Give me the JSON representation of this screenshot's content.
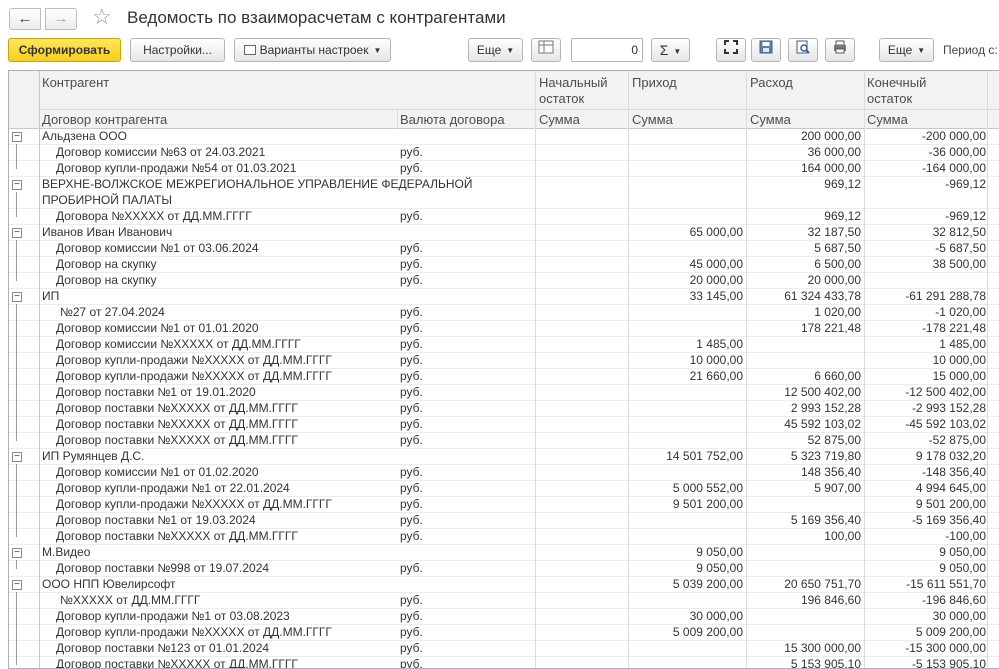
{
  "window": {
    "title": "Ведомость по взаиморасчетам с контрагентами",
    "back_glyph": "←",
    "forward_glyph": "→",
    "star_glyph": "☆"
  },
  "toolbar": {
    "generate_label": "Сформировать",
    "settings_label": "Настройки...",
    "variants_label": "Варианты настроек",
    "more1_label": "Еще",
    "number_value": "0",
    "sigma_label": "Σ",
    "more2_label": "Еще",
    "period_label": "Период с:"
  },
  "table": {
    "headers": {
      "counterparty": "Контрагент",
      "contract": "Договор контрагента",
      "currency": "Валюта договора",
      "opening": "Начальный остаток",
      "income": "Приход",
      "expense": "Расход",
      "closing": "Конечный остаток",
      "sum": "Сумма"
    },
    "rows": [
      {
        "level": 0,
        "name": "Альдзена ООО",
        "cur": "",
        "open": "",
        "inc": "",
        "exp": "200 000,00",
        "close": "-200 000,00"
      },
      {
        "level": 1,
        "name": "Договор комиссии №63 от 24.03.2021",
        "cur": "руб.",
        "open": "",
        "inc": "",
        "exp": "36 000,00",
        "close": "-36 000,00"
      },
      {
        "level": 1,
        "name": "Договор купли-продажи №54 от 01.03.2021",
        "cur": "руб.",
        "open": "",
        "inc": "",
        "exp": "164 000,00",
        "close": "-164 000,00"
      },
      {
        "level": 0,
        "name": "ВЕРХНЕ-ВОЛЖСКОЕ МЕЖРЕГИОНАЛЬНОЕ УПРАВЛЕНИЕ ФЕДЕРАЛЬНОЙ",
        "name2": "ПРОБИРНОЙ ПАЛАТЫ",
        "cur": "",
        "open": "",
        "inc": "",
        "exp": "969,12",
        "close": "-969,12"
      },
      {
        "level": 1,
        "name": "Договора №XXXXX от ДД.ММ.ГГГГ",
        "cur": "руб.",
        "open": "",
        "inc": "",
        "exp": "969,12",
        "close": "-969,12"
      },
      {
        "level": 0,
        "name": "Иванов Иван Иванович",
        "cur": "",
        "open": "",
        "inc": "65 000,00",
        "exp": "32 187,50",
        "close": "32 812,50"
      },
      {
        "level": 1,
        "name": "Договор комиссии №1 от 03.06.2024",
        "cur": "руб.",
        "open": "",
        "inc": "",
        "exp": "5 687,50",
        "close": "-5 687,50"
      },
      {
        "level": 1,
        "name": "Договор на скупку",
        "cur": "руб.",
        "open": "",
        "inc": "45 000,00",
        "exp": "6 500,00",
        "close": "38 500,00"
      },
      {
        "level": 1,
        "name": "Договор на скупку",
        "cur": "руб.",
        "open": "",
        "inc": "20 000,00",
        "exp": "20 000,00",
        "close": ""
      },
      {
        "level": 0,
        "name": "ИП",
        "cur": "",
        "open": "",
        "inc": "33 145,00",
        "exp": "61 324 433,78",
        "close": "-61 291 288,78"
      },
      {
        "level": 2,
        "name": "№27 от 27.04.2024",
        "cur": "руб.",
        "open": "",
        "inc": "",
        "exp": "1 020,00",
        "close": "-1 020,00"
      },
      {
        "level": 1,
        "name": "Договор комиссии №1 от 01.01.2020",
        "cur": "руб.",
        "open": "",
        "inc": "",
        "exp": "178 221,48",
        "close": "-178 221,48"
      },
      {
        "level": 1,
        "name": "Договор комиссии №XXXXX от ДД.ММ.ГГГГ",
        "cur": "руб.",
        "open": "",
        "inc": "1 485,00",
        "exp": "",
        "close": "1 485,00"
      },
      {
        "level": 1,
        "name": "Договор купли-продажи №XXXXX от ДД.ММ.ГГГГ",
        "cur": "руб.",
        "open": "",
        "inc": "10 000,00",
        "exp": "",
        "close": "10 000,00"
      },
      {
        "level": 1,
        "name": "Договор купли-продажи №XXXXX от ДД.ММ.ГГГГ",
        "cur": "руб.",
        "open": "",
        "inc": "21 660,00",
        "exp": "6 660,00",
        "close": "15 000,00"
      },
      {
        "level": 1,
        "name": "Договор поставки №1 от 19.01.2020",
        "cur": "руб.",
        "open": "",
        "inc": "",
        "exp": "12 500 402,00",
        "close": "-12 500 402,00"
      },
      {
        "level": 1,
        "name": "Договор поставки №XXXXX от ДД.ММ.ГГГГ",
        "cur": "руб.",
        "open": "",
        "inc": "",
        "exp": "2 993 152,28",
        "close": "-2 993 152,28"
      },
      {
        "level": 1,
        "name": "Договор поставки №XXXXX от ДД.ММ.ГГГГ",
        "cur": "руб.",
        "open": "",
        "inc": "",
        "exp": "45 592 103,02",
        "close": "-45 592 103,02"
      },
      {
        "level": 1,
        "name": "Договор поставки №XXXXX от ДД.ММ.ГГГГ",
        "cur": "руб.",
        "open": "",
        "inc": "",
        "exp": "52 875,00",
        "close": "-52 875,00"
      },
      {
        "level": 0,
        "name": "ИП Румянцев Д.С.",
        "cur": "",
        "open": "",
        "inc": "14 501 752,00",
        "exp": "5 323 719,80",
        "close": "9 178 032,20"
      },
      {
        "level": 1,
        "name": "Договор комиссии №1 от 01.02.2020",
        "cur": "руб.",
        "open": "",
        "inc": "",
        "exp": "148 356,40",
        "close": "-148 356,40"
      },
      {
        "level": 1,
        "name": "Договор купли-продажи №1 от 22.01.2024",
        "cur": "руб.",
        "open": "",
        "inc": "5 000 552,00",
        "exp": "5 907,00",
        "close": "4 994 645,00"
      },
      {
        "level": 1,
        "name": "Договор купли-продажи №XXXXX от ДД.ММ.ГГГГ",
        "cur": "руб.",
        "open": "",
        "inc": "9 501 200,00",
        "exp": "",
        "close": "9 501 200,00"
      },
      {
        "level": 1,
        "name": "Договор поставки №1 от 19.03.2024",
        "cur": "руб.",
        "open": "",
        "inc": "",
        "exp": "5 169 356,40",
        "close": "-5 169 356,40"
      },
      {
        "level": 1,
        "name": "Договор поставки №XXXXX от ДД.ММ.ГГГГ",
        "cur": "руб.",
        "open": "",
        "inc": "",
        "exp": "100,00",
        "close": "-100,00"
      },
      {
        "level": 0,
        "name": "М.Видео",
        "cur": "",
        "open": "",
        "inc": "9 050,00",
        "exp": "",
        "close": "9 050,00"
      },
      {
        "level": 1,
        "name": "Договор поставки №998 от 19.07.2024",
        "cur": "руб.",
        "open": "",
        "inc": "9 050,00",
        "exp": "",
        "close": "9 050,00"
      },
      {
        "level": 0,
        "name": "ООО НПП Ювелирсофт",
        "cur": "",
        "open": "",
        "inc": "5 039 200,00",
        "exp": "20 650 751,70",
        "close": "-15 611 551,70"
      },
      {
        "level": 2,
        "name": "№XXXXX от ДД.ММ.ГГГГ",
        "cur": "руб.",
        "open": "",
        "inc": "",
        "exp": "196 846,60",
        "close": "-196 846,60"
      },
      {
        "level": 1,
        "name": "Договор купли-продажи №1 от 03.08.2023",
        "cur": "руб.",
        "open": "",
        "inc": "30 000,00",
        "exp": "",
        "close": "30 000,00"
      },
      {
        "level": 1,
        "name": "Договор купли-продажи №XXXXX от ДД.ММ.ГГГГ",
        "cur": "руб.",
        "open": "",
        "inc": "5 009 200,00",
        "exp": "",
        "close": "5 009 200,00"
      },
      {
        "level": 1,
        "name": "Договор поставки №123 от 01.01.2024",
        "cur": "руб.",
        "open": "",
        "inc": "",
        "exp": "15 300 000,00",
        "close": "-15 300 000,00"
      },
      {
        "level": 1,
        "name": "Договор поставки №XXXXX от ДД.ММ.ГГГГ",
        "cur": "руб.",
        "open": "",
        "inc": "",
        "exp": "5 153 905,10",
        "close": "-5 153 905,10"
      }
    ]
  }
}
